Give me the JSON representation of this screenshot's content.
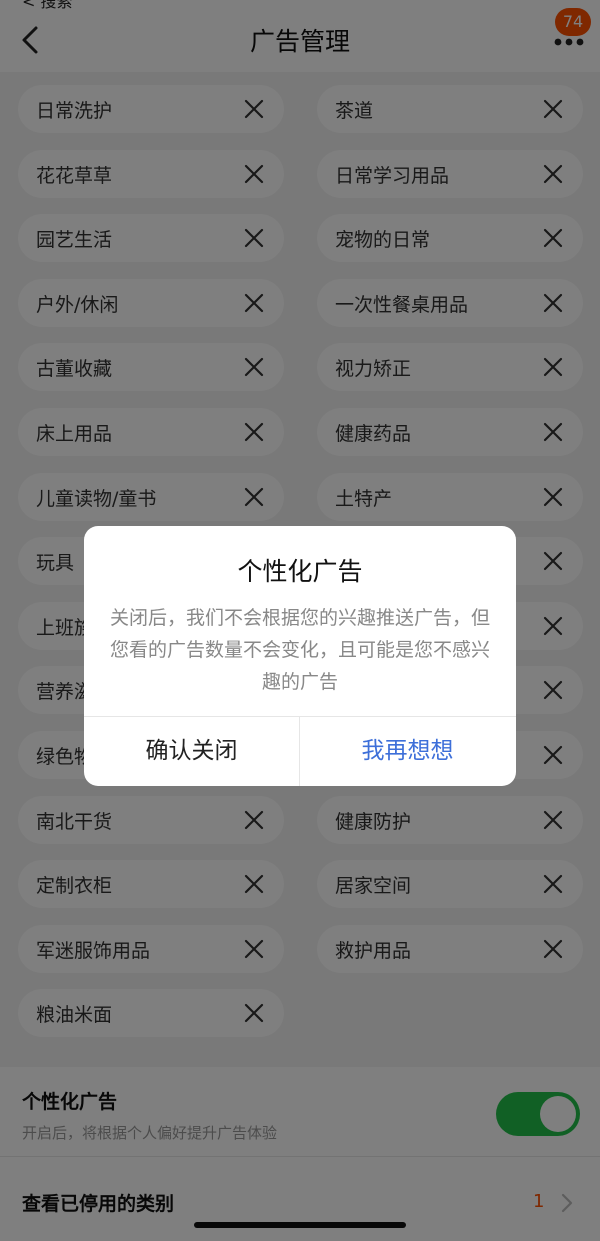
{
  "header": {
    "status_stub": "< 搜索",
    "title": "广告管理",
    "badge_count": "74"
  },
  "tags": [
    "日常洗护",
    "茶道",
    "花花草草",
    "日常学习用品",
    "园艺生活",
    "宠物的日常",
    "户外/休闲",
    "一次性餐桌用品",
    "古董收藏",
    "视力矫正",
    "床上用品",
    "健康药品",
    "儿童读物/童书",
    "土特产",
    "玩具",
    "",
    "上班族",
    "",
    "营养滋",
    "",
    "绿色物",
    "",
    "南北干货",
    "健康防护",
    "定制衣柜",
    "居家空间",
    "军迷服饰用品",
    "救护用品",
    "粮油米面"
  ],
  "settings": {
    "personalized_title": "个性化广告",
    "personalized_desc": "开启后，将根据个人偏好提升广告体验",
    "toggle_on": true,
    "toggle_color": "#22c04a",
    "view_disabled_label": "查看已停用的类别",
    "view_disabled_count": "1"
  },
  "dialog": {
    "title": "个性化广告",
    "message": "关闭后，我们不会根据您的兴趣推送广告，但您看的广告数量不会变化，且可能是您不感兴趣的广告",
    "confirm_label": "确认关闭",
    "cancel_label": "我再想想"
  },
  "colors": {
    "accent_orange": "#ff5000",
    "link_blue": "#3d6fd9"
  }
}
